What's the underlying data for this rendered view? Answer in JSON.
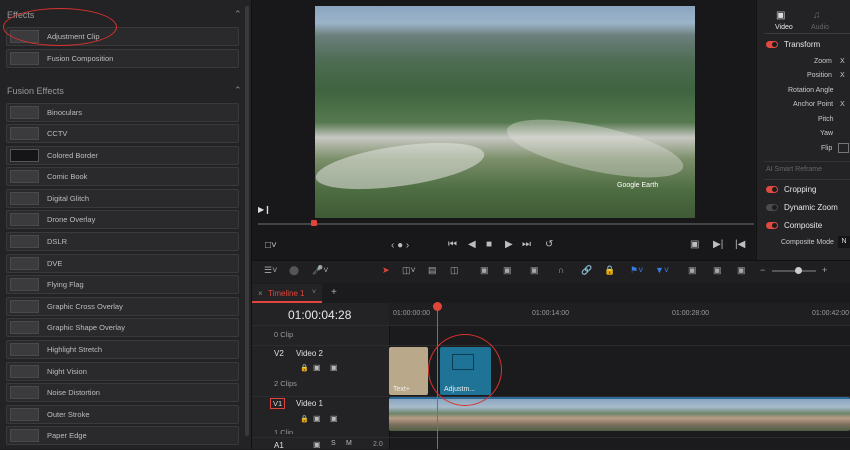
{
  "left_panel": {
    "effects_section": {
      "title": "Effects",
      "items": [
        {
          "label": "Adjustment Clip"
        },
        {
          "label": "Fusion Composition"
        }
      ]
    },
    "fusion_section": {
      "title": "Fusion Effects",
      "items": [
        {
          "label": "Binoculars"
        },
        {
          "label": "CCTV"
        },
        {
          "label": "Colored Border"
        },
        {
          "label": "Comic Book"
        },
        {
          "label": "Digital Glitch"
        },
        {
          "label": "Drone Overlay"
        },
        {
          "label": "DSLR"
        },
        {
          "label": "DVE"
        },
        {
          "label": "Flying Flag"
        },
        {
          "label": "Graphic Cross Overlay"
        },
        {
          "label": "Graphic Shape Overlay"
        },
        {
          "label": "Highlight Stretch"
        },
        {
          "label": "Night Vision"
        },
        {
          "label": "Noise Distortion"
        },
        {
          "label": "Outer Stroke"
        },
        {
          "label": "Paper Edge"
        }
      ]
    }
  },
  "viewer": {
    "watermark": "Google Earth"
  },
  "inspector": {
    "tabs": [
      "Video",
      "Audio"
    ],
    "transform_title": "Transform",
    "rows": [
      {
        "label": "Zoom",
        "value": "X"
      },
      {
        "label": "Position",
        "value": "X"
      },
      {
        "label": "Rotation Angle",
        "value": ""
      },
      {
        "label": "Anchor Point",
        "value": "X"
      },
      {
        "label": "Pitch",
        "value": ""
      },
      {
        "label": "Yaw",
        "value": ""
      },
      {
        "label": "Flip",
        "value": ""
      }
    ],
    "smart_reframe": "AI Smart Reframe",
    "sections": [
      "Cropping",
      "Dynamic Zoom",
      "Composite"
    ],
    "composite_mode_label": "Composite Mode",
    "composite_mode_value": "N"
  },
  "timeline": {
    "tab_label": "Timeline 1",
    "timecode": "01:00:04:28",
    "ruler": [
      "01:00:00:00",
      "01:00:14:00",
      "01:00:28:00",
      "01:00:42:00"
    ],
    "tracks": [
      {
        "id": "",
        "name": "",
        "clips": "0 Clip"
      },
      {
        "id": "V2",
        "name": "Video 2",
        "clips": "2 Clips"
      },
      {
        "id": "V1",
        "name": "Video 1",
        "clips": "1 Clip"
      },
      {
        "id": "A1",
        "name": "",
        "clips": "",
        "level": "2.0"
      }
    ],
    "clip_text_label": "Text+",
    "clip_adjust_label": "Adjustm..."
  },
  "colors": {
    "accent_red": "#e0453a",
    "adjustment_clip": "#1e7396",
    "text_clip": "#b9a88a",
    "annotation_red": "#d8322d"
  }
}
